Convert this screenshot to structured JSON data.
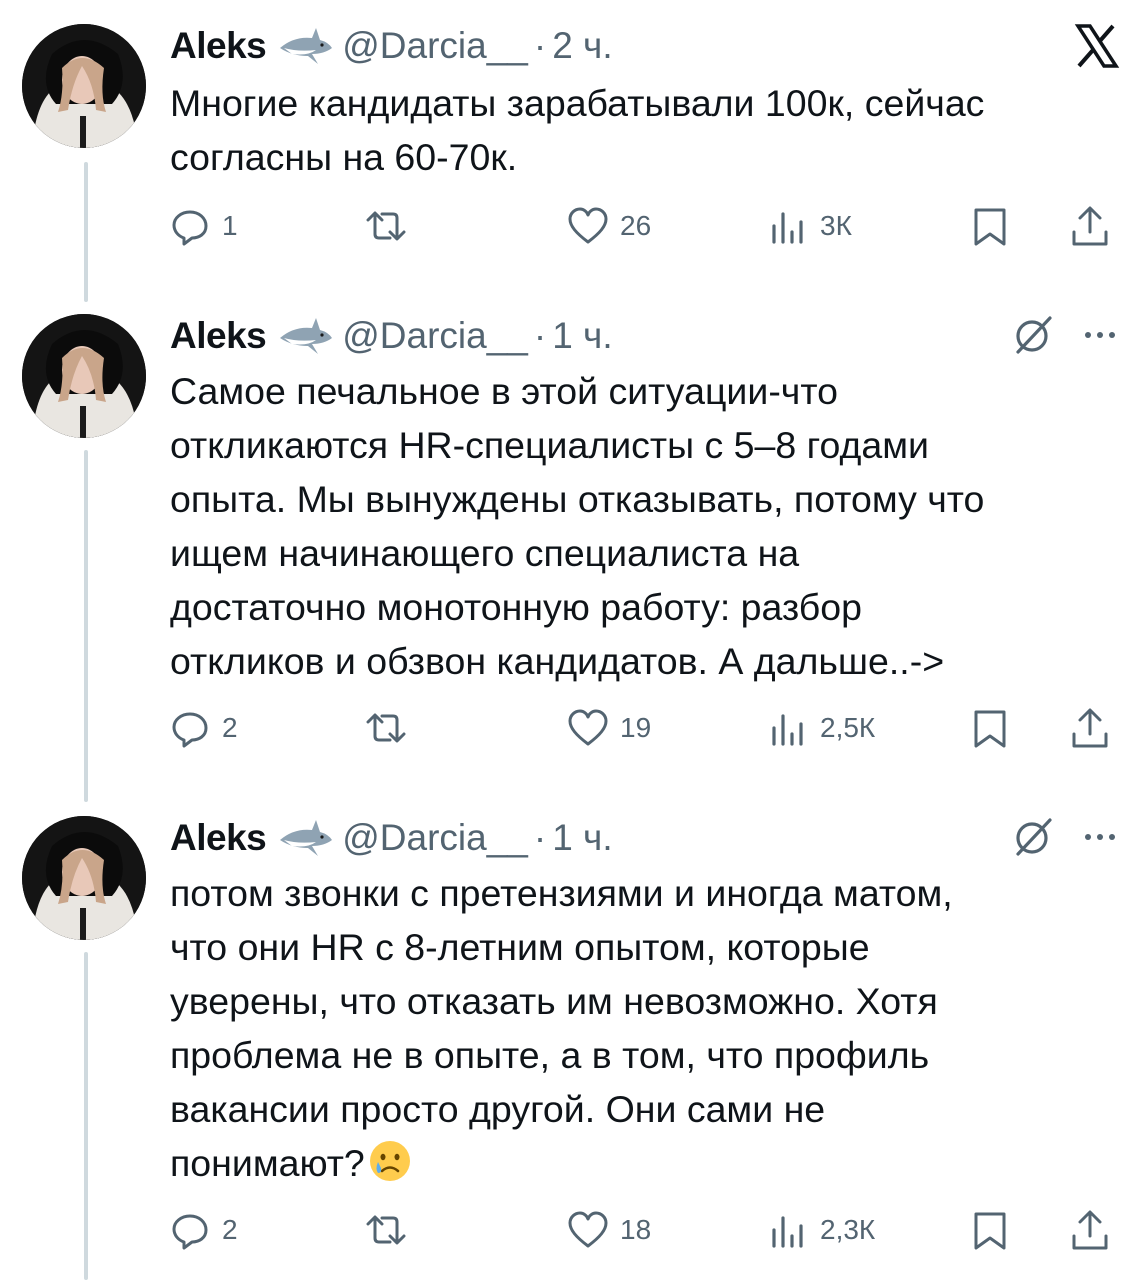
{
  "author": {
    "name": "Aleks",
    "handle": "@Darcia__",
    "badge_icon": "shark-emoji"
  },
  "separator": "·",
  "colors": {
    "text_primary": "#0f1419",
    "text_secondary": "#536471",
    "thread_line": "#cfd9de"
  },
  "tweets": [
    {
      "time": "2 ч.",
      "corner_icon": "x-logo-icon",
      "text": "Многие кандидаты зарабатывали 100к, сейчас\nсогласны на 60-70к.",
      "replies": "1",
      "likes": "26",
      "views": "3К"
    },
    {
      "time": "1 ч.",
      "corner_icon": "grok-icon",
      "text": "Самое печальное в этой ситуации-что\nоткликаются HR-специалисты с 5–8 годами\nопыта. Мы вынуждены отказывать, потому что\nищем начинающего специалиста на\nдостаточно монотонную работу: разбор\nоткликов и обзвон кандидатов. А дальше..->",
      "replies": "2",
      "likes": "19",
      "views": "2,5К"
    },
    {
      "time": "1 ч.",
      "corner_icon": "grok-icon",
      "text": "потом звонки с претензиями и иногда матом,\nчто они HR с 8-летним опытом, которые\nуверены, что отказать им невозможно. Хотя\nпроблема не в опыте, а в том, что профиль\nвакансии просто другой. Они сами не\nпонимают?",
      "trailing_emoji": "crying-face-emoji",
      "replies": "2",
      "likes": "18",
      "views": "2,3К"
    }
  ]
}
